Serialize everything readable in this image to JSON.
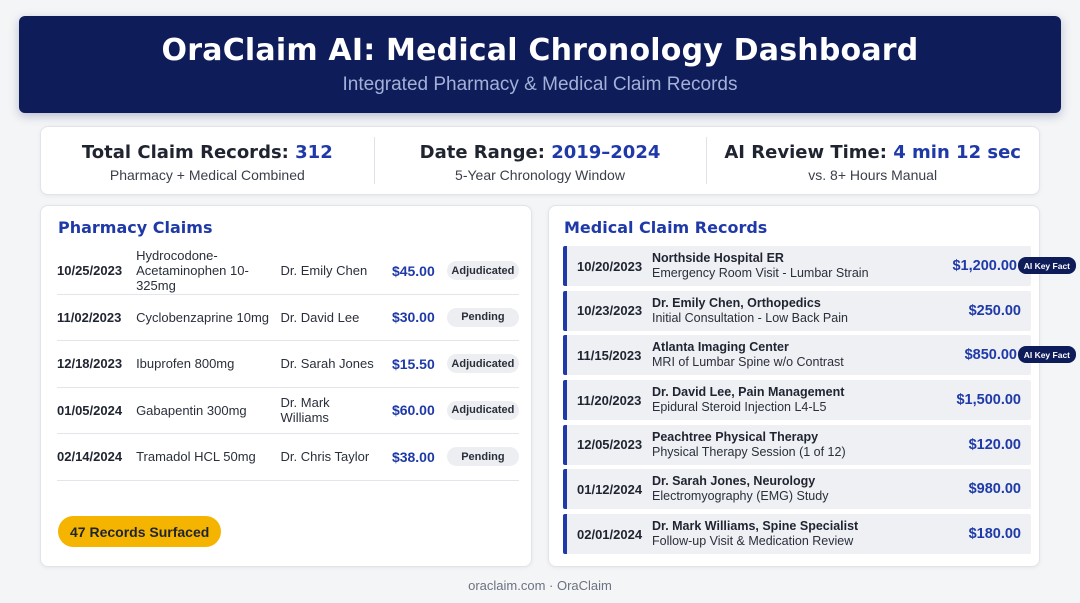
{
  "header": {
    "title": "OraClaim AI: Medical Chronology Dashboard",
    "subtitle": "Integrated Pharmacy & Medical Claim Records"
  },
  "stats": [
    {
      "label": "Total Claim Records:",
      "value": "312",
      "sub": "Pharmacy + Medical Combined"
    },
    {
      "label": "Date Range:",
      "value": "2019–2024",
      "sub": "5-Year Chronology Window"
    },
    {
      "label": "AI Review Time:",
      "value": "4 min 12 sec",
      "sub": "vs. 8+ Hours Manual"
    }
  ],
  "pharmacy": {
    "title": "Pharmacy Claims",
    "rows": [
      {
        "date": "10/25/2023",
        "drug": "Hydrocodone-Acetaminophen 10-325mg",
        "doctor": "Dr. Emily Chen",
        "amount": "$45.00",
        "status": "Adjudicated"
      },
      {
        "date": "11/02/2023",
        "drug": "Cyclobenzaprine 10mg",
        "doctor": "Dr. David Lee",
        "amount": "$30.00",
        "status": "Pending"
      },
      {
        "date": "12/18/2023",
        "drug": "Ibuprofen 800mg",
        "doctor": "Dr. Sarah Jones",
        "amount": "$15.50",
        "status": "Adjudicated"
      },
      {
        "date": "01/05/2024",
        "drug": "Gabapentin 300mg",
        "doctor": "Dr. Mark Williams",
        "amount": "$60.00",
        "status": "Adjudicated"
      },
      {
        "date": "02/14/2024",
        "drug": "Tramadol HCL 50mg",
        "doctor": "Dr. Chris Taylor",
        "amount": "$38.00",
        "status": "Pending"
      }
    ],
    "surfaced_label": "47 Records Surfaced"
  },
  "medical": {
    "title": "Medical Claim Records",
    "rows": [
      {
        "date": "10/20/2023",
        "provider": "Northside Hospital ER",
        "description": "Emergency Room Visit - Lumbar Strain",
        "amount": "$1,200.00",
        "tag": "AI Key Fact"
      },
      {
        "date": "10/23/2023",
        "provider": "Dr. Emily Chen, Orthopedics",
        "description": "Initial Consultation - Low Back Pain",
        "amount": "$250.00",
        "tag": ""
      },
      {
        "date": "11/15/2023",
        "provider": "Atlanta Imaging Center",
        "description": "MRI of Lumbar Spine w/o Contrast",
        "amount": "$850.00",
        "tag": "AI Key Fact"
      },
      {
        "date": "11/20/2023",
        "provider": "Dr. David Lee, Pain Management",
        "description": "Epidural Steroid Injection L4-L5",
        "amount": "$1,500.00",
        "tag": ""
      },
      {
        "date": "12/05/2023",
        "provider": "Peachtree Physical Therapy",
        "description": "Physical Therapy Session (1 of 12)",
        "amount": "$120.00",
        "tag": ""
      },
      {
        "date": "01/12/2024",
        "provider": "Dr. Sarah Jones, Neurology",
        "description": "Electromyography (EMG) Study",
        "amount": "$980.00",
        "tag": ""
      },
      {
        "date": "02/01/2024",
        "provider": "Dr. Mark Williams, Spine Specialist",
        "description": "Follow-up Visit & Medication Review",
        "amount": "$180.00",
        "tag": ""
      }
    ]
  },
  "footer": "oraclaim.com · OraClaim"
}
